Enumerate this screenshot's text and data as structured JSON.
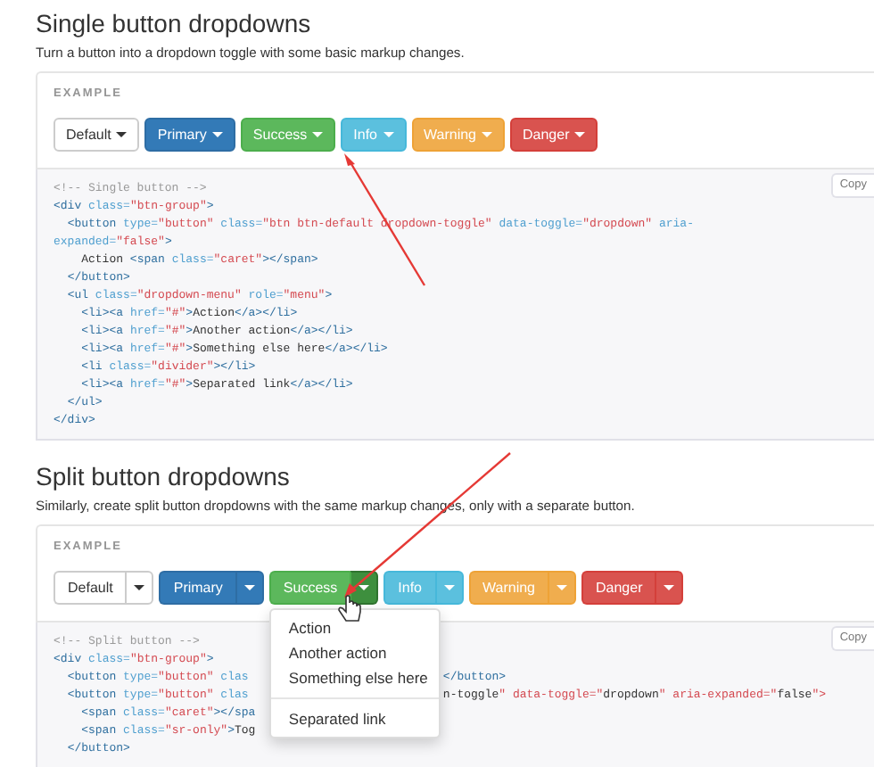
{
  "sections": [
    {
      "title": "Single button dropdowns",
      "description": "Turn a button into a dropdown toggle with some basic markup changes.",
      "example_label": "EXAMPLE",
      "kind": "single",
      "buttons": [
        {
          "label": "Default",
          "open": false
        },
        {
          "label": "Primary",
          "open": false
        },
        {
          "label": "Success",
          "open": false
        },
        {
          "label": "Info",
          "open": false
        },
        {
          "label": "Warning",
          "open": false
        },
        {
          "label": "Danger",
          "open": false
        }
      ],
      "copy": "Copy",
      "code": [
        {
          "text": "<!-- Single button -->"
        },
        {
          "text": "<div class=\"btn-group\">"
        },
        {
          "text": "  <button type=\"button\" class=\"btn btn-default dropdown-toggle\" data-toggle=\"dropdown\" aria-"
        },
        {
          "text": "expanded=\"false\">"
        },
        {
          "text": "    Action <span class=\"caret\"></span>"
        },
        {
          "text": "  </button>"
        },
        {
          "text": "  <ul class=\"dropdown-menu\" role=\"menu\">"
        },
        {
          "text": "    <li><a href=\"#\">Action</a></li>"
        },
        {
          "text": "    <li><a href=\"#\">Another action</a></li>"
        },
        {
          "text": "    <li><a href=\"#\">Something else here</a></li>"
        },
        {
          "text": "    <li class=\"divider\"></li>"
        },
        {
          "text": "    <li><a href=\"#\">Separated link</a></li>"
        },
        {
          "text": "  </ul>"
        },
        {
          "text": "</div>"
        }
      ]
    },
    {
      "title": "Split button dropdowns",
      "description": "Similarly, create split button dropdowns with the same markup changes, only with a separate button.",
      "example_label": "EXAMPLE",
      "kind": "split",
      "buttons": [
        {
          "label": "Default",
          "open": false
        },
        {
          "label": "Primary",
          "open": false
        },
        {
          "label": "Success",
          "open": true,
          "menu": [
            {
              "kind": "item",
              "label": "Action"
            },
            {
              "kind": "item",
              "label": "Another action"
            },
            {
              "kind": "item",
              "label": "Something else here"
            },
            {
              "kind": "divider"
            },
            {
              "kind": "item",
              "label": "Separated link"
            }
          ]
        },
        {
          "label": "Info",
          "open": false
        },
        {
          "label": "Warning",
          "open": false
        },
        {
          "label": "Danger",
          "open": false
        }
      ],
      "copy": "Copy",
      "code": [
        {
          "text": "<!-- Split button -->"
        },
        {
          "text": "<div class=\"btn-group\">"
        },
        {
          "text": "  <button type=\"button\" clas",
          "resumes": "</button>"
        },
        {
          "text": "  <button type=\"button\" clas",
          "resumes": "n-toggle\" data-toggle=\"dropdown\" aria-expanded=\"false\">"
        },
        {
          "text": "    <span class=\"caret\"></spa"
        },
        {
          "text": "    <span class=\"sr-only\">Tog"
        },
        {
          "text": "  </button>"
        }
      ]
    }
  ]
}
